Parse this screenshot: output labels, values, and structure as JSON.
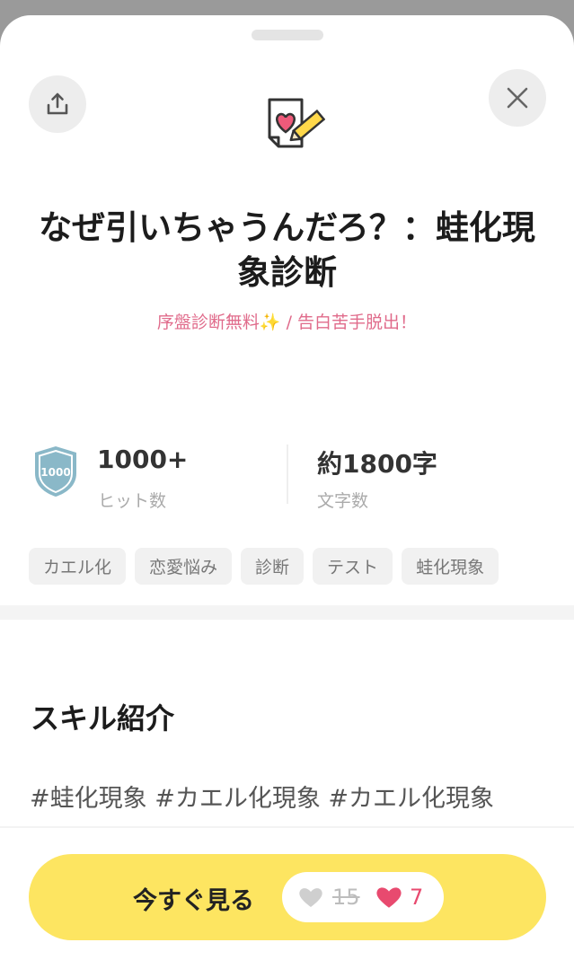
{
  "header": {
    "share_icon": "share-upload-icon",
    "close_icon": "close-icon",
    "hero_icon": "letter-heart-pencil-icon"
  },
  "title": "なぜ引いちゃうんだろ？：蛙化現象診断",
  "subtitle": "序盤診断無料✨ / 告白苦手脱出！",
  "stats": {
    "badge_text": "1000",
    "hits_value": "1000+",
    "hits_label": "ヒット数",
    "chars_value": "約1800字",
    "chars_label": "文字数"
  },
  "tags": [
    "カエル化",
    "恋愛悩み",
    "診断",
    "テスト",
    "蛙化現象"
  ],
  "skill": {
    "title": "スキル紹介",
    "text": "#蛙化現象 #カエル化現象 #カエル化現象"
  },
  "cta": {
    "label": "今すぐ見る",
    "old_price": "15",
    "new_price": "7"
  },
  "colors": {
    "accent_yellow": "#fde561",
    "pink": "#e06b8b",
    "heart": "#e84a6f"
  }
}
